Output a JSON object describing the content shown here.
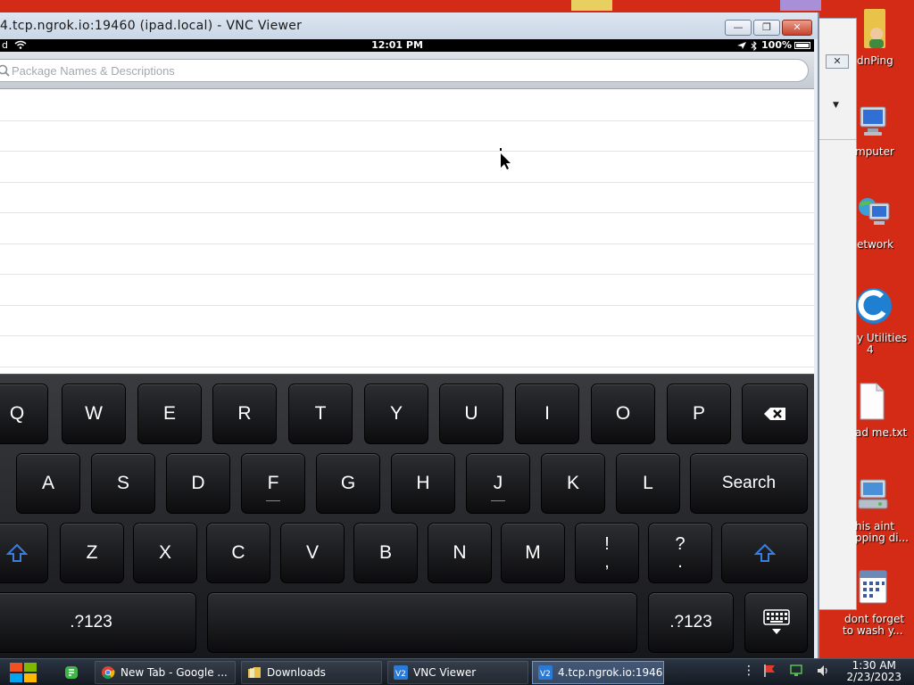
{
  "colors": {
    "desktop_red": "#d32b15",
    "keyboard_dark": "#1e1f22",
    "shift_blue": "#3a7fe0"
  },
  "window": {
    "title": "4.tcp.ngrok.io:19460 (ipad.local) - VNC Viewer",
    "controls": {
      "minimize_glyph": "—",
      "maximize_glyph": "❐",
      "close_glyph": "✕"
    }
  },
  "ipad": {
    "status": {
      "carrier": "d",
      "time": "12:01 PM",
      "battery": "100%"
    },
    "search": {
      "placeholder": "Package Names & Descriptions",
      "value": ""
    },
    "list_rows": 9,
    "keyboard": {
      "row1": [
        "Q",
        "W",
        "E",
        "R",
        "T",
        "Y",
        "U",
        "I",
        "O",
        "P"
      ],
      "row2": [
        "A",
        "S",
        "D",
        "F",
        "G",
        "H",
        "J",
        "K",
        "L"
      ],
      "search_key": "Search",
      "row3": [
        "Z",
        "X",
        "C",
        "V",
        "B",
        "N",
        "M"
      ],
      "punct1": {
        "top": "!",
        "bottom": ","
      },
      "punct2": {
        "top": "?",
        "bottom": "."
      },
      "numbers_key": ".?123",
      "backspace_icon": "backspace-icon",
      "shift_icon": "shift-icon",
      "hide_icon": "keyboard-hide-icon"
    }
  },
  "desktop": {
    "icons": [
      {
        "label": "dnPing",
        "icon": "user-folder-icon"
      },
      {
        "label": "mputer",
        "icon": "computer-icon"
      },
      {
        "label": "etwork",
        "icon": "network-icon"
      },
      {
        "label": "y Utilities",
        "label2": "4",
        "icon": "utilities-icon"
      },
      {
        "label": "ad me.txt",
        "icon": "text-file-icon"
      },
      {
        "label": "his aint",
        "label2": "pping di...",
        "icon": "installer-icon"
      },
      {
        "label": "dont forget",
        "label2": "to wash y...",
        "icon": "calendar-icon"
      }
    ]
  },
  "taskbar": {
    "apps": [
      {
        "label": "",
        "icon": "greenshot-icon"
      },
      {
        "label": "New Tab - Google ...",
        "icon": "chrome-icon"
      },
      {
        "label": "Downloads",
        "icon": "folder-icon"
      },
      {
        "label": "VNC Viewer",
        "icon": "vnc-icon"
      },
      {
        "label": "4.tcp.ngrok.io:1946...",
        "icon": "vnc-icon"
      }
    ],
    "clock": {
      "time": "1:30 AM",
      "date": "2/23/2023"
    }
  }
}
